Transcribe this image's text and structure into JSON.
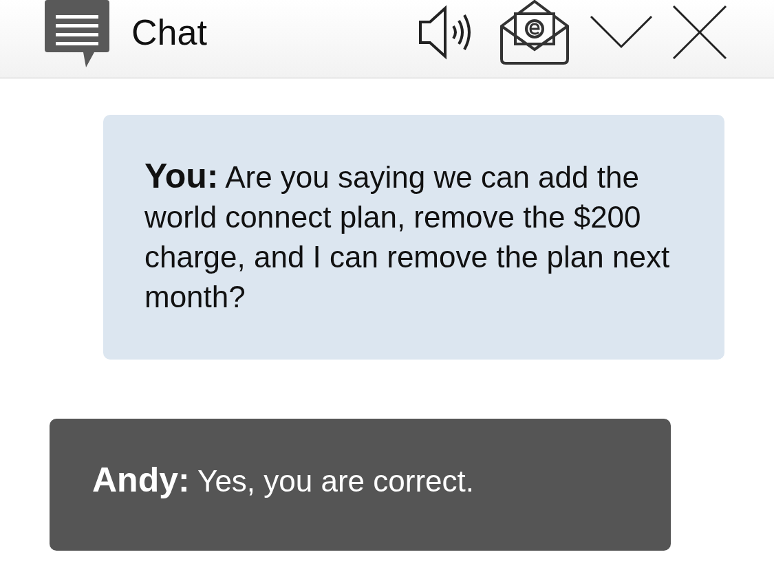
{
  "header": {
    "title": "Chat"
  },
  "messages": [
    {
      "kind": "sent",
      "text": "**You:** Are you saying we can add the world connect plan, remove the $200 charge, and I can remove the plan next month?"
    },
    {
      "kind": "received",
      "text": "**Andy:** Yes, you are correct."
    }
  ]
}
